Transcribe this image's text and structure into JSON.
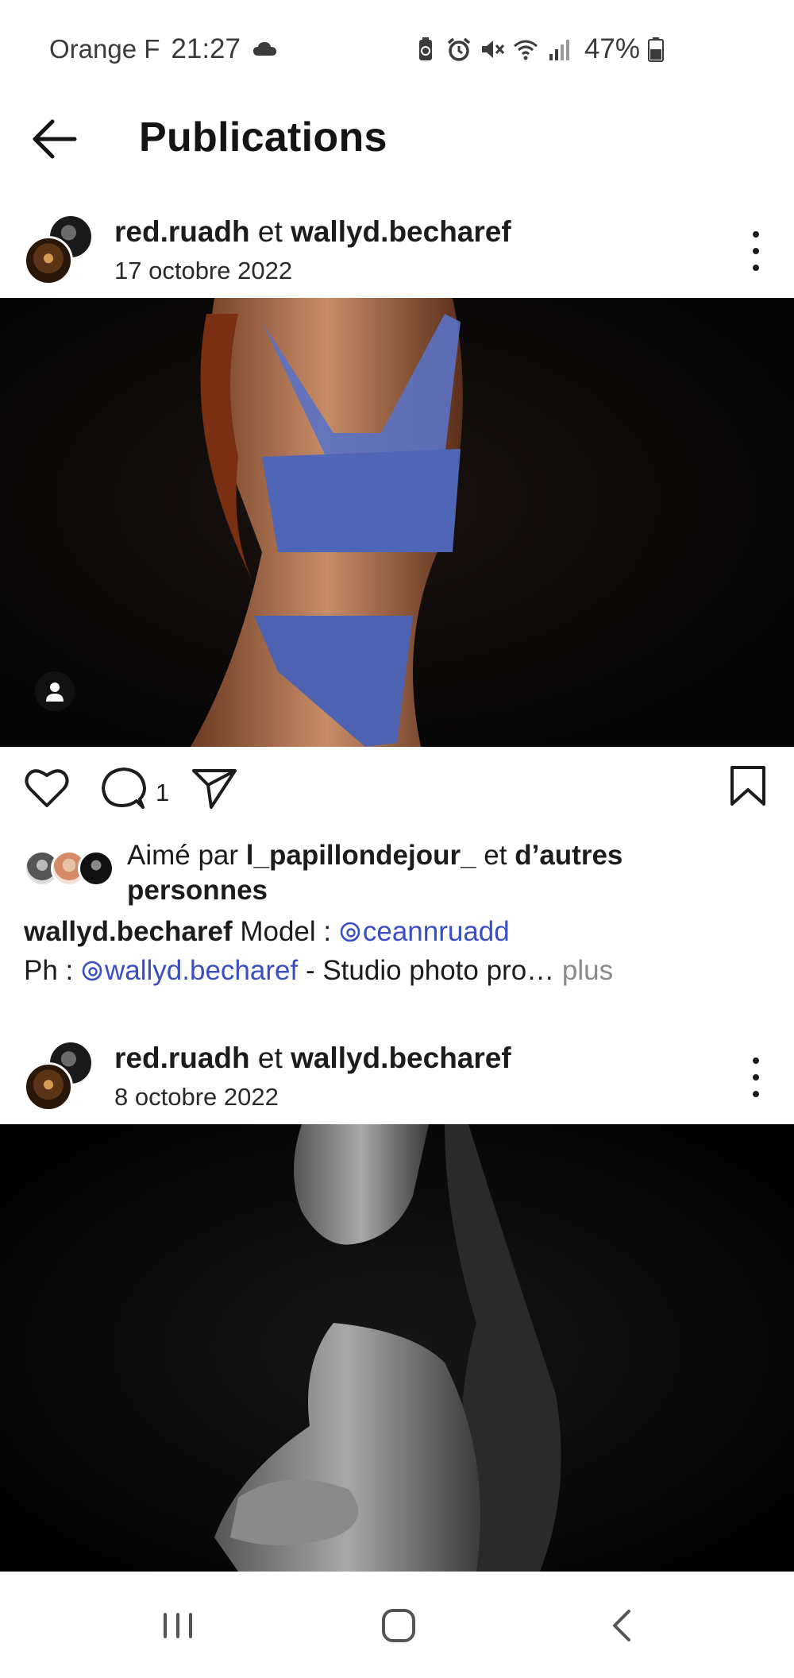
{
  "status_bar": {
    "carrier": "Orange F",
    "time": "21:27",
    "battery": "47%",
    "icons": [
      "cloud-icon",
      "battery-saver-icon",
      "alarm-icon",
      "mute-icon",
      "wifi-icon",
      "signal-icon",
      "battery-icon"
    ]
  },
  "header": {
    "title": "Publications",
    "back_icon": "arrow-left-icon"
  },
  "posts": [
    {
      "author1": "red.ruadh",
      "conjunction": "et",
      "author2": "wallyd.becharef",
      "date": "17 octobre 2022",
      "comment_count": "1",
      "likes": {
        "prefix": "Aimé par",
        "user": "l_papillondejour_",
        "mid": "et",
        "suffix": "d’autres personnes"
      },
      "caption": {
        "user": "wallyd.becharef",
        "text1": "Model :",
        "mention1": "ceannruadd",
        "text2": "Ph :",
        "mention2": "wallyd.becharef",
        "text3": "- Studio photo pro…",
        "more": "plus"
      }
    },
    {
      "author1": "red.ruadh",
      "conjunction": "et",
      "author2": "wallyd.becharef",
      "date": "8 octobre 2022"
    }
  ],
  "nav": {
    "recents_icon": "recents-icon",
    "home_icon": "home-icon",
    "back_icon": "back-chevron-icon"
  }
}
